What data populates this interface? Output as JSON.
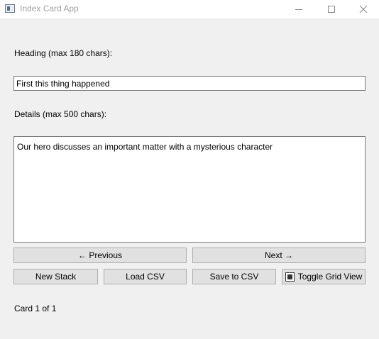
{
  "window": {
    "title": "Index Card App",
    "icons": {
      "app": "app-window-icon",
      "minimize": "minimize-icon",
      "maximize": "maximize-icon",
      "close": "close-icon"
    }
  },
  "form": {
    "heading_label": "Heading (max 180 chars):",
    "heading_value": "First this thing happened",
    "details_label": "Details (max 500 chars):",
    "details_value": "Our hero discusses an important matter with a mysterious character"
  },
  "navigation": {
    "previous_label": "← Previous",
    "next_label": "Next →"
  },
  "actions": {
    "new_stack_label": "New Stack",
    "load_csv_label": "Load CSV",
    "save_csv_label": "Save to CSV",
    "toggle_grid_label": "Toggle Grid View",
    "toggle_grid_checked": true
  },
  "status": {
    "card_position": "Card 1 of 1"
  }
}
